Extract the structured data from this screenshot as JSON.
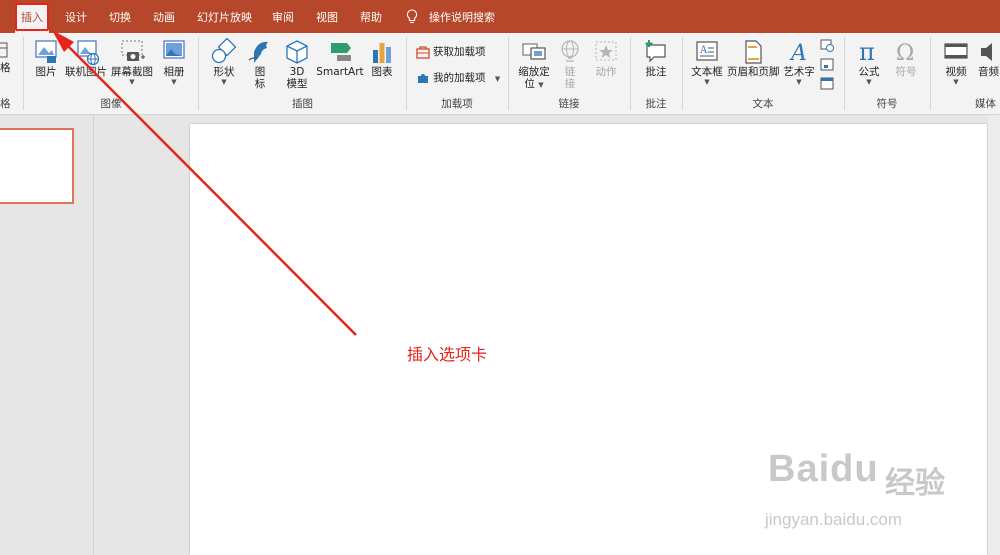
{
  "tabs": [
    {
      "label": "插入",
      "active": true
    },
    {
      "label": "设计"
    },
    {
      "label": "切换"
    },
    {
      "label": "动画"
    },
    {
      "label": "幻灯片放映"
    },
    {
      "label": "审阅"
    },
    {
      "label": "视图"
    },
    {
      "label": "帮助"
    }
  ],
  "tell_me": "操作说明搜索",
  "ribbon": {
    "partial_left_label": "格",
    "partial_left_group": "格",
    "images": {
      "pictures": "图片",
      "online_pictures": "联机图片",
      "screenshot": "屏幕截图",
      "album": "相册",
      "group": "图像"
    },
    "illustrations": {
      "shapes": "形状",
      "icons_1": "图",
      "icons_2": "标",
      "model_1": "3D",
      "model_2": "模型",
      "smartart": "SmartArt",
      "chart": "图表",
      "group": "插图"
    },
    "addins": {
      "get": "获取加载项",
      "my": "我的加载项",
      "group": "加载项"
    },
    "links": {
      "zoom_1": "缩放定",
      "zoom_2": "位",
      "link_1": "链",
      "link_2": "接",
      "action": "动作",
      "group": "链接"
    },
    "comments": {
      "comment": "批注",
      "group": "批注"
    },
    "text": {
      "textbox": "文本框",
      "header_footer": "页眉和页脚",
      "wordart": "艺术字",
      "group": "文本"
    },
    "symbols": {
      "equation": "公式",
      "symbol": "符号",
      "group": "符号"
    },
    "media": {
      "video": "视频",
      "audio": "音频",
      "group": "媒体"
    }
  },
  "annotation": "插入选项卡",
  "watermark": {
    "brand": "Baidu",
    "cn": "经验",
    "url": "jingyan.baidu.com"
  },
  "colors": {
    "accent": "#b7472a",
    "annotation": "#e8231b"
  }
}
